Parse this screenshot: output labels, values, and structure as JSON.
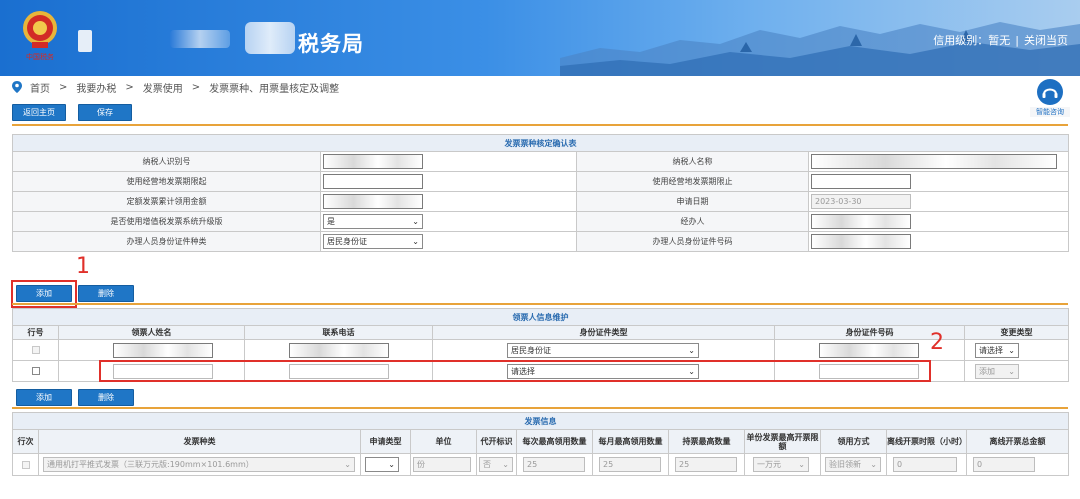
{
  "header": {
    "site_title_suffix": "税务局",
    "credit_label": "信用级别：暂无",
    "close_label": "关闭当页",
    "separator": "|",
    "emblem_text": "中国税务",
    "colors": {
      "primary": "#1f76c6",
      "accent_orange": "#e8a33a",
      "annotation_red": "#e0302a"
    }
  },
  "breadcrumb": {
    "separator": ">",
    "items": [
      "首页",
      "我要办税",
      "发票使用",
      "发票票种、用票量核定及调整"
    ]
  },
  "assistant": {
    "label": "智能咨询",
    "icon": "headset-icon"
  },
  "toolbar": {
    "home_label": "返回主页",
    "save_label": "保存"
  },
  "confirm_table": {
    "title": "发票票种核定确认表",
    "rows": [
      {
        "left_label": "纳税人识别号",
        "left_value": "",
        "right_label": "纳税人名称",
        "right_value": ""
      },
      {
        "left_label": "使用经营地发票期限起",
        "left_value": "",
        "right_label": "使用经营地发票期限止",
        "right_value": ""
      },
      {
        "left_label": "定额发票累计领用金额",
        "left_value": "",
        "right_label": "申请日期",
        "right_value": "2023-03-30"
      },
      {
        "left_label": "是否使用增值税发票系统升级版",
        "left_value": "是",
        "right_label": "经办人",
        "right_value": ""
      },
      {
        "left_label": "办理人员身份证件种类",
        "left_value": "居民身份证",
        "right_label": "办理人员身份证件号码",
        "right_value": ""
      }
    ]
  },
  "annotations": {
    "one": "1",
    "two": "2"
  },
  "collector_section": {
    "add_label": "添加",
    "delete_label": "删除",
    "title": "领票人信息维护",
    "headers": [
      "行号",
      "领票人姓名",
      "联系电话",
      "身份证件类型",
      "身份证件号码",
      "变更类型"
    ],
    "rows": [
      {
        "name": "",
        "phone": "",
        "id_type": "居民身份证",
        "id_number": "",
        "change_type": "请选择"
      },
      {
        "name": "",
        "phone": "",
        "id_type": "请选择",
        "id_number": "",
        "change_type": "添加"
      }
    ]
  },
  "invoice_section": {
    "add_label": "添加",
    "delete_label": "删除",
    "title": "发票信息",
    "headers": [
      "行次",
      "发票种类",
      "申请类型",
      "单位",
      "代开标识",
      "每次最高领用数量",
      "每月最高领用数量",
      "持票最高数量",
      "单份发票最高开票限额",
      "领用方式",
      "离线开票时限（小时）",
      "离线开票总金额"
    ],
    "rows": [
      {
        "type": "通用机打平推式发票（三联万元版:190mm×101.6mm）",
        "apply_type": "",
        "unit": "份",
        "agent_flag": "否",
        "per_time": "25",
        "per_month": "25",
        "max_hold": "25",
        "max_limit": "一万元",
        "method": "验旧领新",
        "offline_hours": "0",
        "offline_amount": "0"
      }
    ]
  }
}
